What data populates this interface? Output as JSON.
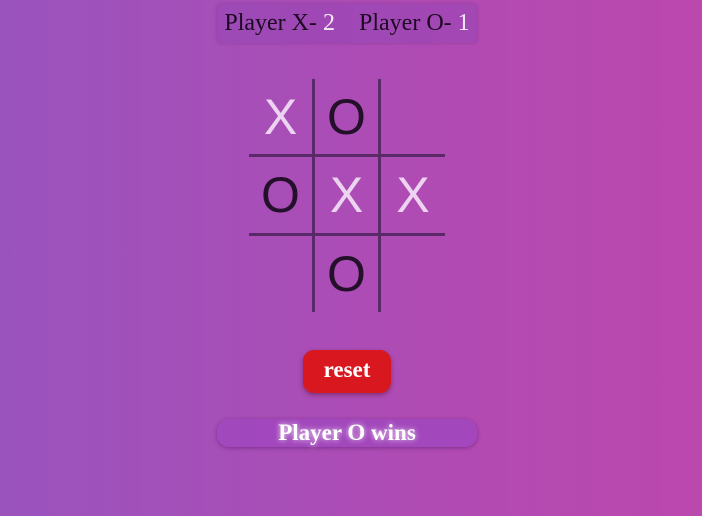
{
  "scoreboard": {
    "player_x_label": "Player X-",
    "player_x_score": "2",
    "player_o_label": "Player O-",
    "player_o_score": "1"
  },
  "board": {
    "cells": [
      "X",
      "O",
      "",
      "O",
      "X",
      "X",
      "",
      "O",
      ""
    ]
  },
  "controls": {
    "reset_label": "reset"
  },
  "status": {
    "message": "Player O wins"
  },
  "colors": {
    "x_mark": "#ecd3ef",
    "o_mark": "#25102b",
    "grid_line": "#5a2a68",
    "reset_button": "#d8171f",
    "background_start": "#9a53bd",
    "background_end": "#bb48ad"
  }
}
